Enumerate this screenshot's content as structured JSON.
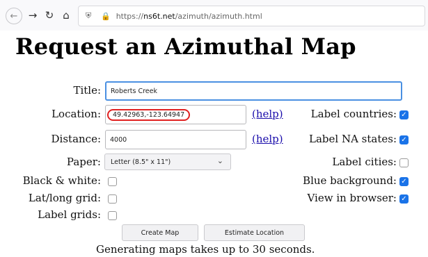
{
  "browser": {
    "url_prefix": "https://",
    "url_host": "ns6t.net",
    "url_path": "/azimuth/azimuth.html"
  },
  "page": {
    "title": "Request an Azimuthal Map",
    "note": "Generating maps takes up to 30 seconds."
  },
  "form": {
    "title_label": "Title:",
    "title_value": "Roberts Creek",
    "location_label": "Location:",
    "location_value": "49.42963,-123.64947",
    "distance_label": "Distance:",
    "distance_value": "4000",
    "help_text": "(help)",
    "paper_label": "Paper:",
    "paper_value": "Letter (8.5\" x 11\")",
    "bw_label": "Black & white:",
    "latlong_label": "Lat/long grid:",
    "labelgrids_label": "Label grids:",
    "label_countries": "Label countries:",
    "label_na_states": "Label NA states:",
    "label_cities": "Label cities:",
    "blue_background": "Blue background:",
    "view_in_browser": "View in browser:"
  },
  "buttons": {
    "create": "Create Map",
    "estimate": "Estimate Location"
  },
  "checkbox_states": {
    "label_countries": true,
    "label_na_states": true,
    "label_cities": false,
    "blue_background": true,
    "view_in_browser": true,
    "black_white": false,
    "latlong_grid": false,
    "label_grids": false
  },
  "icons": {
    "back": "back-arrow-icon",
    "forward": "forward-arrow-icon",
    "reload": "reload-icon",
    "home": "home-icon",
    "tracking": "shield-icon",
    "secure": "lock-icon",
    "dropdown": "chevron-down-icon"
  },
  "colors": {
    "accent": "#1a73e8",
    "focus": "#4a90e2",
    "highlight": "#e02020",
    "link": "#1a0dab"
  }
}
